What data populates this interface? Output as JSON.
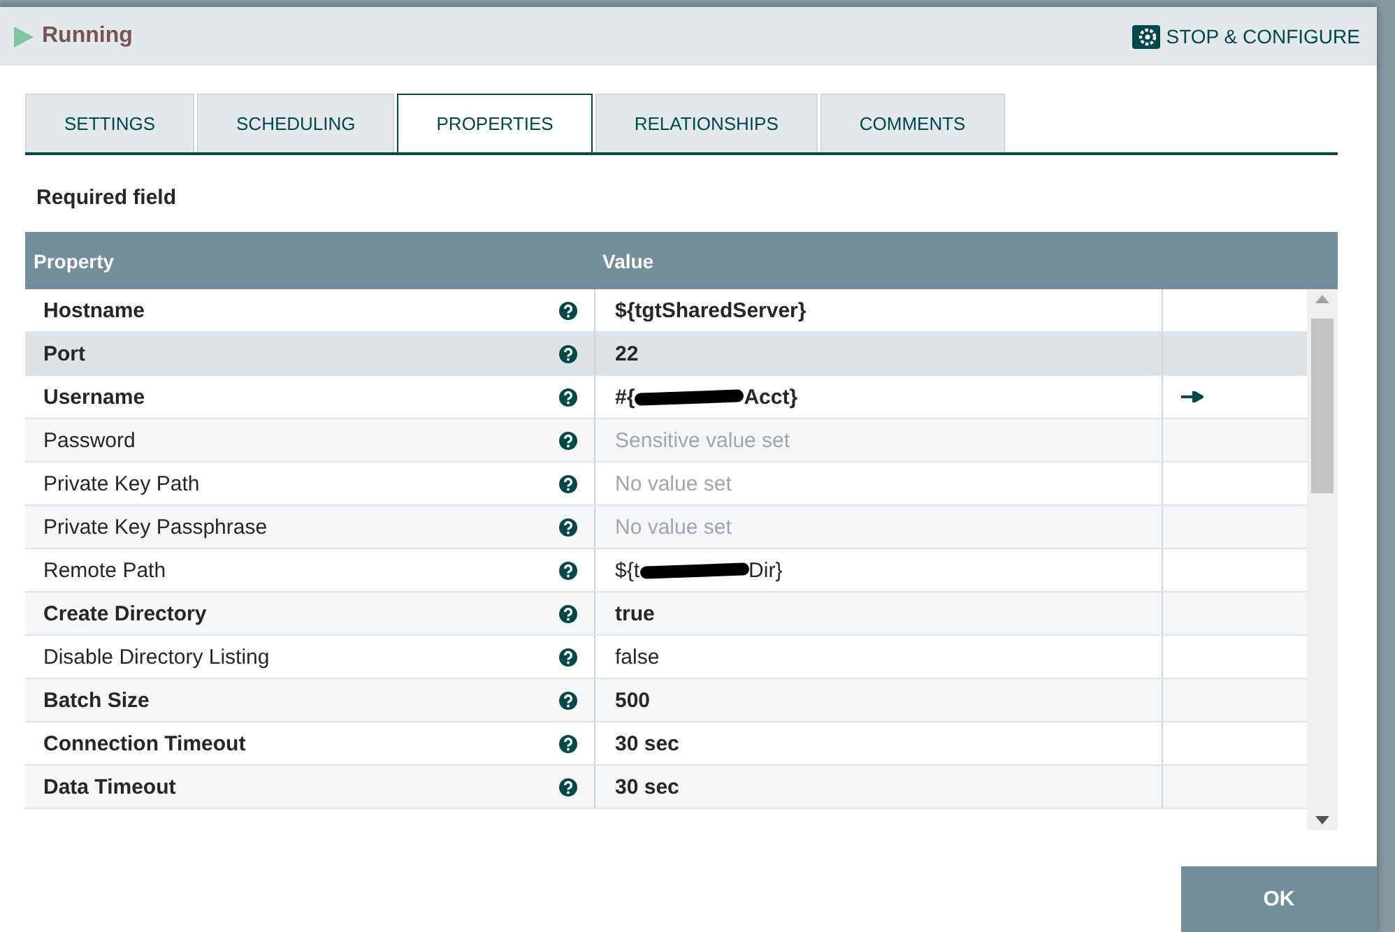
{
  "header": {
    "status": "Running",
    "action": "STOP & CONFIGURE"
  },
  "tabs": [
    {
      "label": "SETTINGS",
      "selected": false
    },
    {
      "label": "SCHEDULING",
      "selected": false
    },
    {
      "label": "PROPERTIES",
      "selected": true
    },
    {
      "label": "RELATIONSHIPS",
      "selected": false
    },
    {
      "label": "COMMENTS",
      "selected": false
    }
  ],
  "required_note": "Required field",
  "table": {
    "columns": [
      "Property",
      "Value"
    ],
    "rows": [
      {
        "property": "Hostname",
        "required": true,
        "value": "${tgtSharedServer}",
        "unset": false,
        "selected": false
      },
      {
        "property": "Port",
        "required": true,
        "value": "22",
        "unset": false,
        "selected": true
      },
      {
        "property": "Username",
        "required": true,
        "value": "#{",
        "redacted": true,
        "value_end": "Acct}",
        "unset": false,
        "selected": false,
        "go_to": true
      },
      {
        "property": "Password",
        "required": false,
        "value": "Sensitive value set",
        "unset": true,
        "selected": false
      },
      {
        "property": "Private Key Path",
        "required": false,
        "value": "No value set",
        "unset": true,
        "selected": false
      },
      {
        "property": "Private Key Passphrase",
        "required": false,
        "value": "No value set",
        "unset": true,
        "selected": false
      },
      {
        "property": "Remote Path",
        "required": false,
        "value": "${t",
        "redacted": true,
        "value_end": "Dir}",
        "unset": false,
        "selected": false
      },
      {
        "property": "Create Directory",
        "required": true,
        "value": "true",
        "unset": false,
        "selected": false
      },
      {
        "property": "Disable Directory Listing",
        "required": false,
        "value": "false",
        "unset": false,
        "selected": false
      },
      {
        "property": "Batch Size",
        "required": true,
        "value": "500",
        "unset": false,
        "selected": false
      },
      {
        "property": "Connection Timeout",
        "required": true,
        "value": "30 sec",
        "unset": false,
        "selected": false
      },
      {
        "property": "Data Timeout",
        "required": true,
        "value": "30 sec",
        "unset": false,
        "selected": false
      }
    ]
  },
  "buttons": [
    "OK"
  ]
}
